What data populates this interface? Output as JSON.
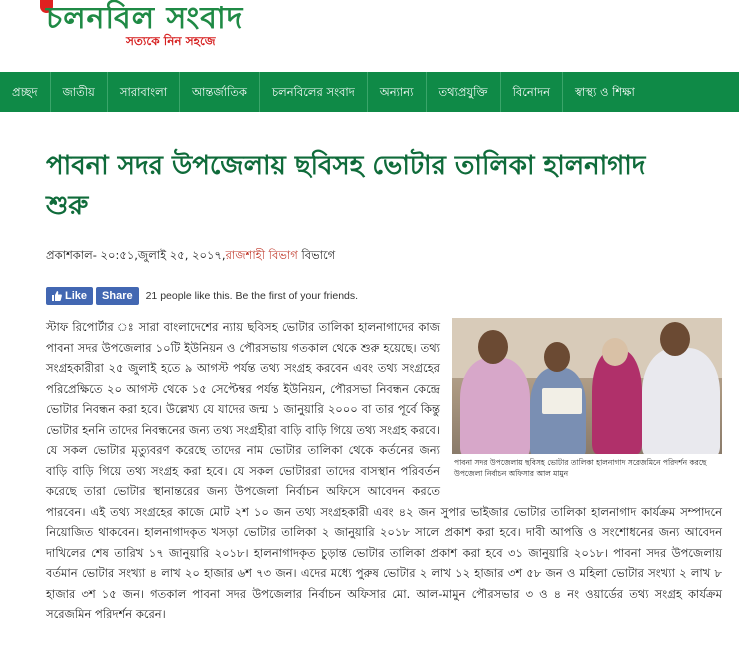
{
  "logo": {
    "name": "চলনবিল সংবাদ",
    "tagline": "সত্যকে নিন সহজে"
  },
  "nav": {
    "items": [
      "প্রচ্ছদ",
      "জাতীয়",
      "সারাবাংলা",
      "আন্তর্জাতিক",
      "চলনবিলের সংবাদ",
      "অন্যান্য",
      "তথ্যপ্রযুক্তি",
      "বিনোদন",
      "স্বাস্থ্য ও শিক্ষা"
    ]
  },
  "article": {
    "title": "পাবনা সদর উপজেলায় ছবিসহ ভোটার তালিকা হালনাগাদ শুরু",
    "meta_prefix": "প্রকাশকাল- ২০:৫১,জুলাই ২৫, ২০১৭,",
    "meta_division": "রাজশাহী বিভাগ",
    "meta_suffix": " বিভাগে",
    "body": "স্টাফ রিপোর্টার ঃ সারা বাংলাদেশের ন্যায় ছবিসহ ভোটার তালিকা হালনাগাদের কাজ পাবনা সদর উপজেলার ১০টি ইউনিয়ন ও পৌরসভায় গতকাল থেকে শুরু হয়েছে। তথ্য সংগ্রহকারীরা ২৫ জুলাই হতে ৯ আগস্ট পর্যন্ত তথ্য সংগ্রহ করবেন এবং তথ্য সংগ্রহের পরিপ্রেক্ষিতে ২০ আগস্ট থেকে ১৫ সেপ্টেম্বর পর্যন্ত ইউনিয়ন, পৌরসভা নিবন্ধন কেন্দ্রে ভোটার নিবন্ধন করা হবে। উল্লেখ্য যে যাদের জন্ম ১ জানুয়ারি ২০০০ বা তার পূর্বে কিন্তু ভোটার হননি তাদের নিবন্ধনের জন্য তথ্য সংগ্রহীরা বাড়ি বাড়ি গিয়ে তথ্য সংগ্রহ করবে। যে সকল ভোটার মৃত্যুবরণ করেছে তাদের নাম ভোটার তালিকা থেকে কর্তনের জন্য বাড়ি বাড়ি গিয়ে তথ্য সংগ্রহ করা হবে। যে সকল ভোটাররা তাদের বাসস্থান পরিবর্তন করেছে তারা ভোটার স্থানান্তরের জন্য উপজেলা নির্বাচন অফিসে আবেদন করতে পারবেন। এই তথ্য সংগ্রহের কাজে মোট ২শ ১০ জন তথ্য সংগ্রহকারী এবং ৪২ জন সুপার ভাইজার ভোটার তালিকা হালনাগাদ কার্যক্রম সম্পাদনে নিয়োজিত থাকবেন। হালনাগাদকৃত খসড়া ভোটার তালিকা ২ জানুয়ারি ২০১৮ সালে প্রকাশ করা হবে। দাবী আপত্তি ও সংশোধনের জন্য আবেদন দাখিলের শেষ তারিখ ১৭ জানুয়ারি ২০১৮। হালনাগাদকৃত চুড়ান্ত ভোটার তালিকা প্রকাশ করা হবে ৩১ জানুয়ারি ২০১৮। পাবনা সদর উপজেলায় বর্তমান ভোটার সংখ্যা ৪ লাখ ২০ হাজার ৬শ ৭৩ জন। এদের মধ্যে পুরুষ ভোটার ২ লাখ ১২ হাজার ৩শ ৫৮ জন ও মহিলা ভোটার সংখ্যা ২ লাখ ৮ হাজার ৩শ ১৫ জন। গতকাল পাবনা সদর উপজেলার নির্বাচন অফিসার মো. আল-মামুন পৌরসভার ৩ ও ৪ নং ওয়ার্ডের তথ্য সংগ্রহ কার্যক্রম সরেজমিন পরিদর্শন করেন।",
    "photo_caption": "পাবনা সদর উপজেলায় ছবিসহ ভোটার তালিকা হালনাগাদ সরেজমিনে পরিদর্শন করছে উপজেলা নির্বাচন অফিসার আল মামুন"
  },
  "social": {
    "like_label": "Like",
    "share_label": "Share",
    "text": "21 people like this. Be the first of your friends.",
    "icon": "thumbs-up-icon"
  },
  "colors": {
    "nav_bg": "#0f8a47",
    "title": "#0f6b3a",
    "brand_red": "#d62020",
    "facebook": "#4267b2"
  }
}
